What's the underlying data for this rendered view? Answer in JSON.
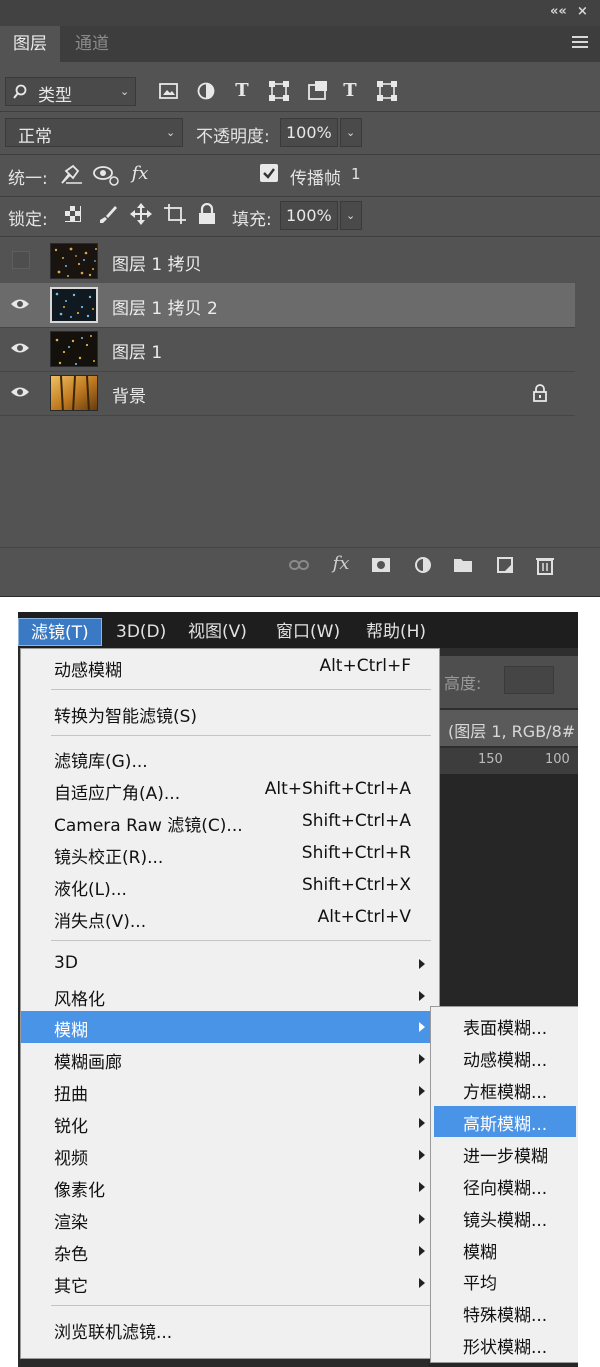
{
  "layers_panel": {
    "top_buttons": [
      "««",
      "×"
    ],
    "tabs": [
      "图层",
      "通道"
    ],
    "filter_kind": "类型",
    "blend_mode": "正常",
    "opacity_label": "不透明度:",
    "opacity_value": "100%",
    "unify_label": "统一:",
    "propagate_frame_label": "传播帧",
    "propagate_frame_value": "1",
    "lock_label": "锁定:",
    "fill_label": "填充:",
    "fill_value": "100%",
    "layers": [
      {
        "name": "图层 1 拷贝",
        "visible": false,
        "selected": false,
        "locked": false,
        "thumb": "sparkle"
      },
      {
        "name": "图层 1 拷贝 2",
        "visible": true,
        "selected": true,
        "locked": false,
        "thumb": "sparkle-blue"
      },
      {
        "name": "图层 1",
        "visible": true,
        "selected": false,
        "locked": false,
        "thumb": "sparkle"
      },
      {
        "name": "背景",
        "visible": true,
        "selected": false,
        "locked": true,
        "thumb": "forest"
      }
    ],
    "colors": {
      "panel_bg": "#535353",
      "selected_row": "#6b6b6b",
      "text": "#ececec"
    }
  },
  "filter_menu": {
    "menubar": [
      "滤镜(T)",
      "3D(D)",
      "视图(V)",
      "窗口(W)",
      "帮助(H)"
    ],
    "bg_fragments": {
      "option_label": "高度:",
      "doc_tab": "(图层 1, RGB/8#",
      "ruler_marks": [
        "150",
        "100"
      ]
    },
    "items": [
      {
        "label": "动感模糊",
        "shortcut": "Alt+Ctrl+F"
      },
      {
        "label": "转换为智能滤镜(S)",
        "shortcut": ""
      },
      {
        "label": "滤镜库(G)...",
        "shortcut": ""
      },
      {
        "label": "自适应广角(A)...",
        "shortcut": "Alt+Shift+Ctrl+A"
      },
      {
        "label": "Camera Raw 滤镜(C)...",
        "shortcut": "Shift+Ctrl+A"
      },
      {
        "label": "镜头校正(R)...",
        "shortcut": "Shift+Ctrl+R"
      },
      {
        "label": "液化(L)...",
        "shortcut": "Shift+Ctrl+X"
      },
      {
        "label": "消失点(V)...",
        "shortcut": "Alt+Ctrl+V"
      },
      {
        "label": "3D",
        "shortcut": ""
      },
      {
        "label": "风格化",
        "shortcut": ""
      },
      {
        "label": "模糊",
        "shortcut": ""
      },
      {
        "label": "模糊画廊",
        "shortcut": ""
      },
      {
        "label": "扭曲",
        "shortcut": ""
      },
      {
        "label": "锐化",
        "shortcut": ""
      },
      {
        "label": "视频",
        "shortcut": ""
      },
      {
        "label": "像素化",
        "shortcut": ""
      },
      {
        "label": "渲染",
        "shortcut": ""
      },
      {
        "label": "杂色",
        "shortcut": ""
      },
      {
        "label": "其它",
        "shortcut": ""
      },
      {
        "label": "浏览联机滤镜...",
        "shortcut": ""
      }
    ],
    "submenu": [
      "表面模糊...",
      "动感模糊...",
      "方框模糊...",
      "高斯模糊...",
      "进一步模糊",
      "径向模糊...",
      "镜头模糊...",
      "模糊",
      "平均",
      "特殊模糊...",
      "形状模糊..."
    ],
    "highlighted_item": "模糊",
    "highlighted_subitem": "高斯模糊...",
    "colors": {
      "highlight": "#4a94e8",
      "menu_bg": "#f0f0f0",
      "menubar_bg": "#1e1e1e"
    }
  }
}
